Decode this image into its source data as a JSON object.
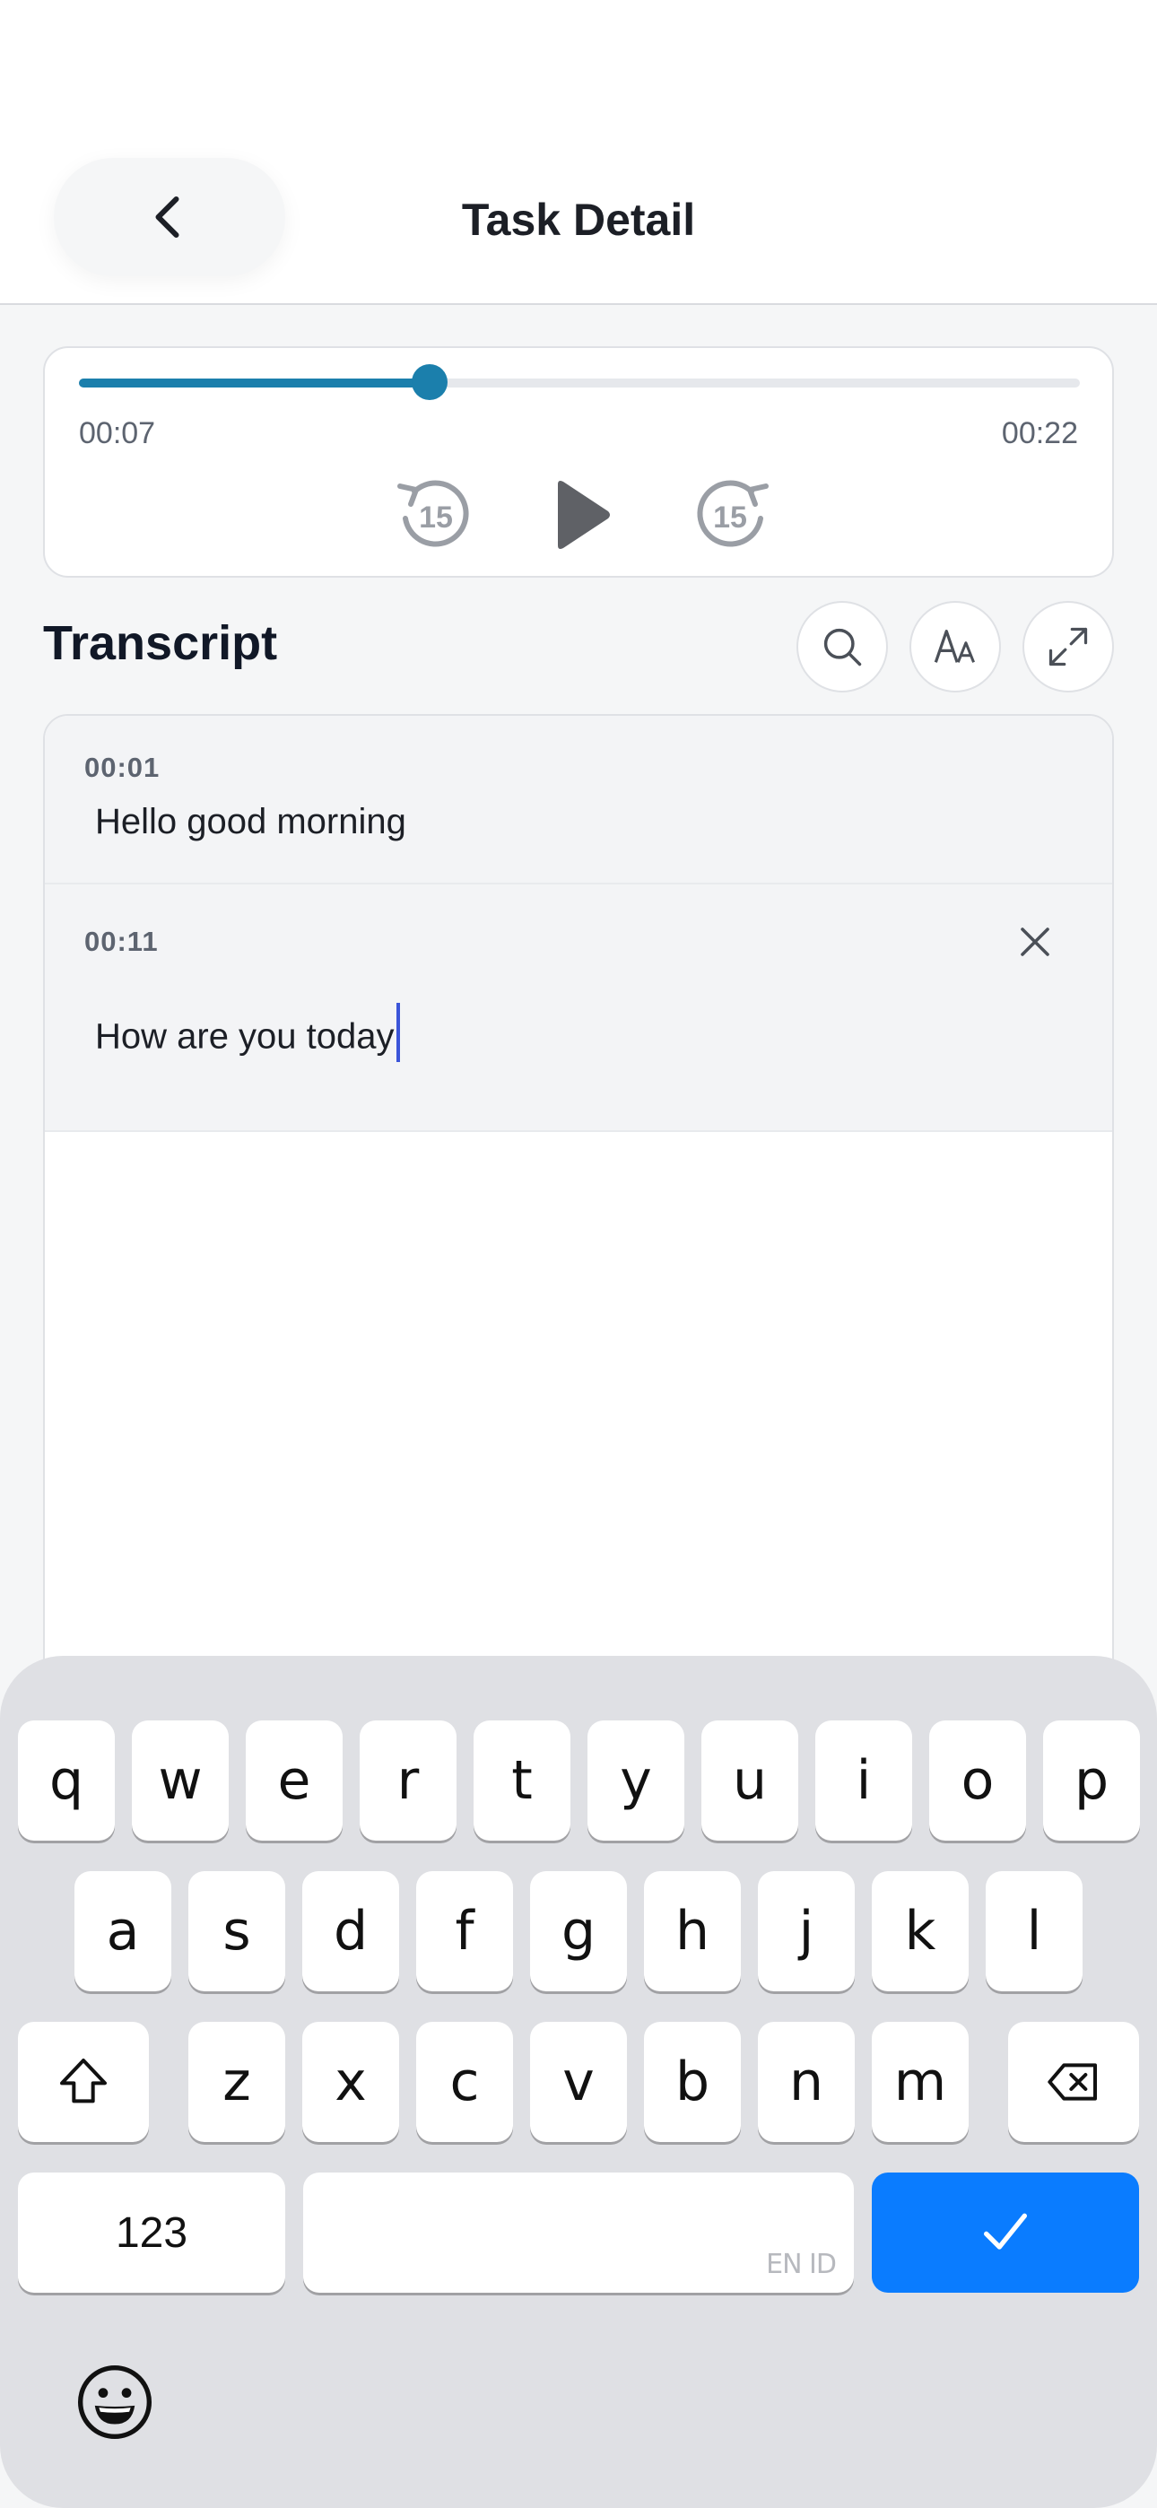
{
  "header": {
    "title": "Task Detail"
  },
  "player": {
    "current_time": "00:07",
    "total_time": "00:22",
    "progress": 0.35,
    "skip_seconds": "15",
    "accent_color": "#1b7fac"
  },
  "transcript": {
    "title": "Transcript",
    "segments": [
      {
        "time": "00:01",
        "text": "Hello good morning"
      },
      {
        "time": "00:11",
        "text": "How are you today"
      }
    ]
  },
  "keyboard": {
    "row1": [
      "q",
      "w",
      "e",
      "r",
      "t",
      "y",
      "u",
      "i",
      "o",
      "p"
    ],
    "row2": [
      "a",
      "s",
      "d",
      "f",
      "g",
      "h",
      "j",
      "k",
      "l"
    ],
    "row3": [
      "z",
      "x",
      "c",
      "v",
      "b",
      "n",
      "m"
    ],
    "numbers_label": "123",
    "space_hint": "EN ID",
    "done_color": "#0a7cff"
  },
  "icons": {
    "back": "chevron-left-icon",
    "rewind": "rewind-15-icon",
    "play": "play-icon",
    "forward": "forward-15-icon",
    "search": "search-icon",
    "font": "font-size-icon",
    "expand": "expand-icon",
    "close": "close-icon",
    "shift": "shift-icon",
    "backspace": "backspace-icon",
    "done": "checkmark-icon",
    "emoji": "emoji-icon"
  }
}
